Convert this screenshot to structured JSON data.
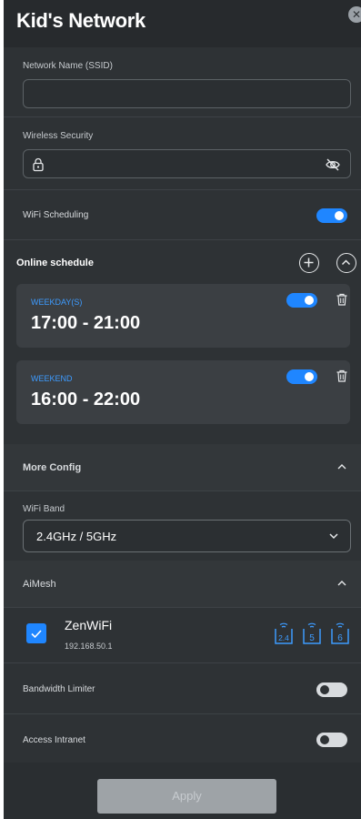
{
  "header": {
    "title": "Kid's Network"
  },
  "ssid": {
    "label": "Network Name (SSID)",
    "value": ""
  },
  "security": {
    "label": "Wireless Security",
    "value": ""
  },
  "wifi_scheduling": {
    "label": "WiFi Scheduling",
    "enabled": true
  },
  "online_schedule": {
    "title": "Online schedule",
    "items": [
      {
        "type": "WEEKDAY(S)",
        "time": "17:00 - 21:00",
        "enabled": true
      },
      {
        "type": "WEEKEND",
        "time": "16:00 - 22:00",
        "enabled": true
      }
    ]
  },
  "more_config": {
    "title": "More Config",
    "wifi_band_label": "WiFi Band",
    "wifi_band_value": "2.4GHz / 5GHz"
  },
  "aimesh": {
    "title": "AiMesh",
    "device": {
      "name": "ZenWiFi",
      "ip": "192.168.50.1",
      "checked": true,
      "bands": [
        "2.4",
        "5",
        "6"
      ]
    }
  },
  "bandwidth_limiter": {
    "label": "Bandwidth Limiter",
    "enabled": false
  },
  "access_intranet": {
    "label": "Access Intranet",
    "enabled": false
  },
  "apply": {
    "label": "Apply"
  },
  "colors": {
    "accent": "#1f86ff",
    "panel_bg": "#2e3235",
    "card_bg": "#3b3f43"
  }
}
